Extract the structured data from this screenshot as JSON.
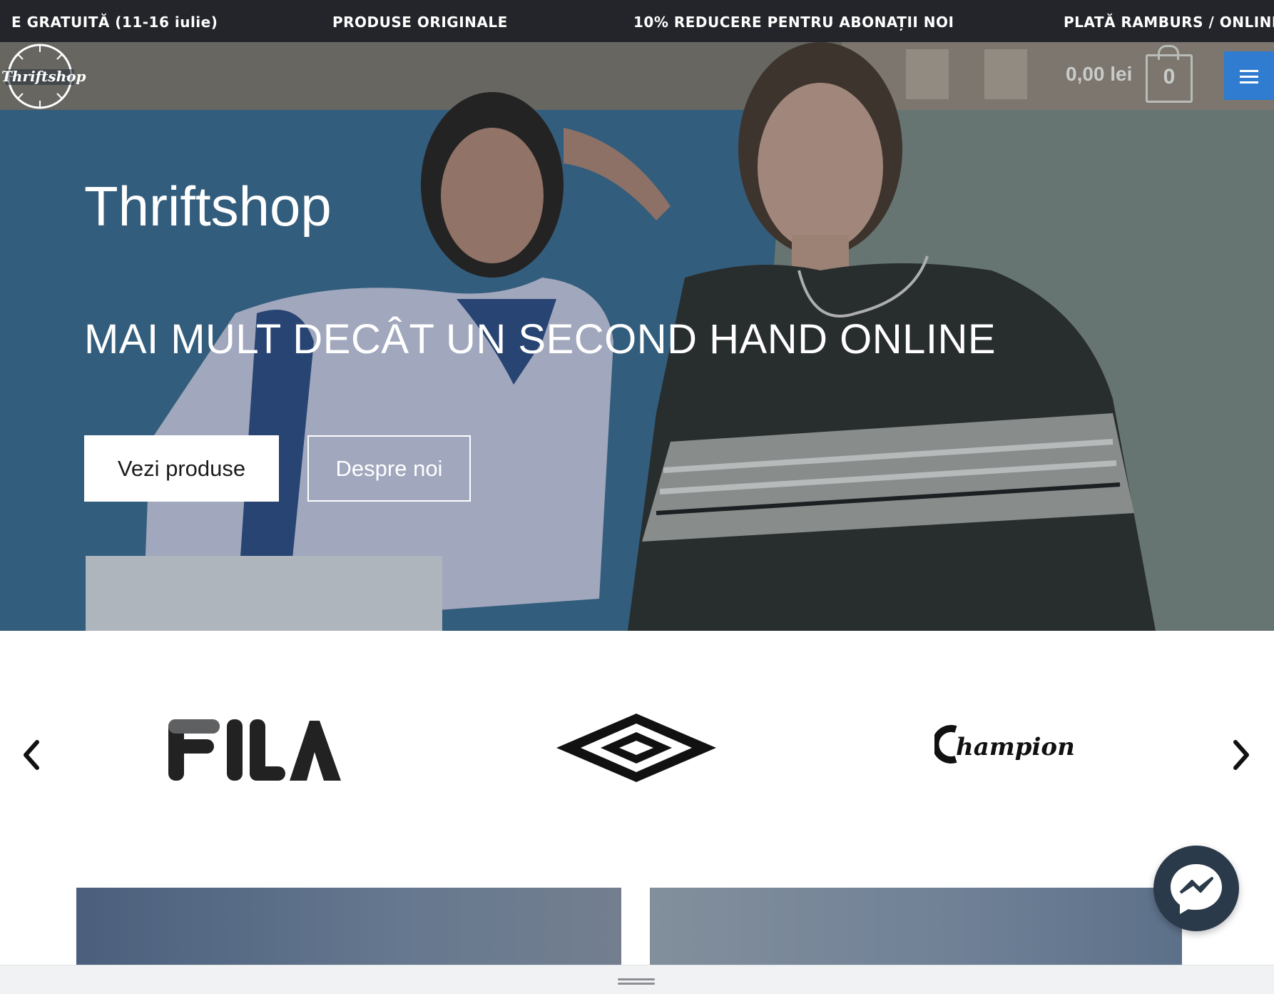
{
  "announcement_bar": {
    "messages": [
      "E GRATUITĂ (11-16 iulie)",
      "PRODUSE ORIGINALE",
      "10% REDUCERE PENTRU ABONAȚII NOI",
      "PLATĂ RAMBURS / ONLINE"
    ]
  },
  "header": {
    "logo_text": "Thriftshop",
    "cart_total": "0,00 lei",
    "cart_count": "0",
    "menu_icon": "hamburger-icon"
  },
  "hero": {
    "title": "Thriftshop",
    "subtitle": "MAI MULT DECÂT UN SECOND HAND ONLINE",
    "primary_button": "Vezi produse",
    "secondary_button": "Despre noi"
  },
  "brands": {
    "items": [
      "FILA",
      "Umbro",
      "Champion"
    ],
    "prev_icon": "chevron-left-icon",
    "next_icon": "chevron-right-icon"
  },
  "chat_widget": {
    "icon": "messenger-icon"
  },
  "colors": {
    "topbar_bg": "#23252a",
    "menu_button_bg": "#2f7cd0",
    "messenger_bg": "#2b3a4a"
  }
}
